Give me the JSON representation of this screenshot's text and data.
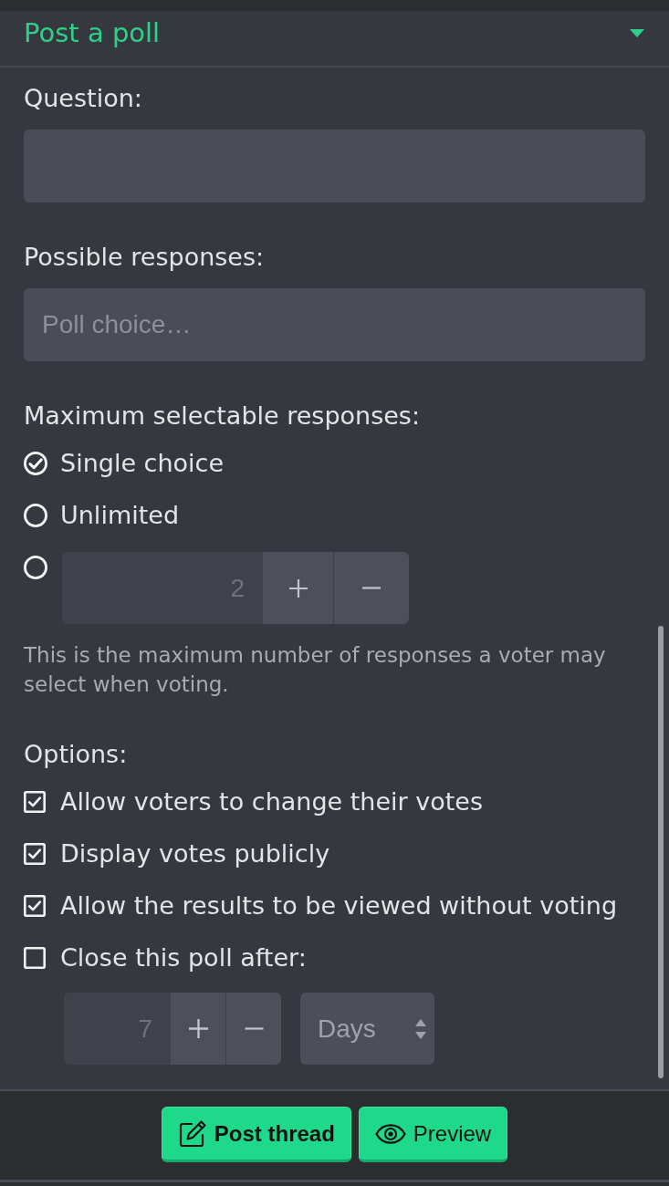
{
  "header": {
    "title": "Post a poll",
    "expanded": true
  },
  "question": {
    "label": "Question:"
  },
  "responses": {
    "label": "Possible responses:",
    "placeholder": "Poll choice…"
  },
  "max_responses": {
    "label": "Maximum selectable responses:",
    "choices": [
      {
        "kind": "option",
        "label": "Single choice",
        "selected": true
      },
      {
        "kind": "option",
        "label": "Unlimited",
        "selected": false
      },
      {
        "kind": "count",
        "value": "2",
        "selected": false
      }
    ],
    "help": "This is the maximum number of responses a voter may select when voting."
  },
  "options": {
    "label": "Options:",
    "items": [
      {
        "kind": "toggle",
        "label": "Allow voters to change their votes",
        "checked": true
      },
      {
        "kind": "toggle",
        "label": "Display votes publicly",
        "checked": true
      },
      {
        "kind": "toggle",
        "label": "Allow the results to be viewed without voting",
        "checked": true
      },
      {
        "kind": "duration",
        "label": "Close this poll after:",
        "checked": false,
        "value": "7",
        "unit": "Days"
      }
    ]
  },
  "actions": [
    {
      "kind": "submit",
      "label": "Post thread"
    },
    {
      "kind": "preview",
      "label": "Preview"
    }
  ]
}
